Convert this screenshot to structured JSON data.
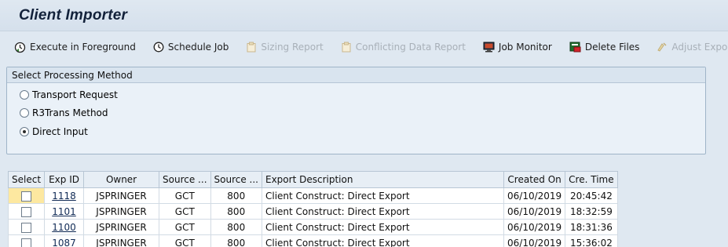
{
  "title": "Client Importer",
  "toolbar": {
    "items": [
      {
        "label": "Execute in Foreground",
        "icon": "execute-clock-icon",
        "enabled": true
      },
      {
        "label": "Schedule Job",
        "icon": "clock-icon",
        "enabled": true
      },
      {
        "label": "Sizing Report",
        "icon": "report-icon",
        "enabled": false
      },
      {
        "label": "Conflicting Data Report",
        "icon": "report-icon",
        "enabled": false
      },
      {
        "label": "Job Monitor",
        "icon": "monitor-icon",
        "enabled": true
      },
      {
        "label": "Delete Files",
        "icon": "delete-files-icon",
        "enabled": true
      },
      {
        "label": "Adjust Export I",
        "icon": "adjust-icon",
        "enabled": false
      }
    ]
  },
  "processing": {
    "heading": "Select Processing Method",
    "options": [
      {
        "label": "Transport Request",
        "selected": false
      },
      {
        "label": "R3Trans Method",
        "selected": false
      },
      {
        "label": "Direct Input",
        "selected": true
      }
    ]
  },
  "table": {
    "columns": [
      "Select",
      "Exp ID",
      "Owner",
      "Source ...",
      "Source ...",
      "Export Description",
      "Created On",
      "Cre. Time"
    ],
    "rows": [
      {
        "exp_id": "1118",
        "owner": "JSPRINGER",
        "source1": "GCT",
        "source2": "800",
        "description": "Client Construct: Direct Export",
        "created_on": "06/10/2019",
        "time": "20:45:42"
      },
      {
        "exp_id": "1101",
        "owner": "JSPRINGER",
        "source1": "GCT",
        "source2": "800",
        "description": "Client Construct: Direct Export",
        "created_on": "06/10/2019",
        "time": "18:32:59"
      },
      {
        "exp_id": "1100",
        "owner": "JSPRINGER",
        "source1": "GCT",
        "source2": "800",
        "description": "Client Construct: Direct Export",
        "created_on": "06/10/2019",
        "time": "18:31:36"
      },
      {
        "exp_id": "1087",
        "owner": "JSPRINGER",
        "source1": "GCT",
        "source2": "800",
        "description": "Client Construct: Direct Export",
        "created_on": "06/10/2019",
        "time": "15:36:02"
      }
    ]
  }
}
